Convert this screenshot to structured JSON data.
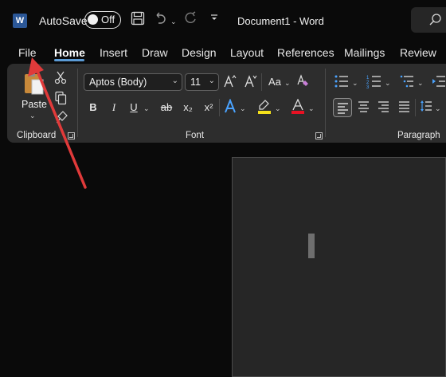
{
  "titlebar": {
    "autosave_label": "AutoSave",
    "autosave_state": "Off",
    "document_title": "Document1  -  Word",
    "icons": [
      "word-logo-icon",
      "save-icon",
      "undo-icon",
      "redo-icon",
      "customize-toolbar-icon",
      "search-icon"
    ]
  },
  "tabs": [
    {
      "label": "File"
    },
    {
      "label": "Home",
      "active": true
    },
    {
      "label": "Insert"
    },
    {
      "label": "Draw"
    },
    {
      "label": "Design"
    },
    {
      "label": "Layout"
    },
    {
      "label": "References"
    },
    {
      "label": "Mailings"
    },
    {
      "label": "Review"
    }
  ],
  "ribbon": {
    "clipboard": {
      "group_label": "Clipboard",
      "paste_label": "Paste"
    },
    "font": {
      "group_label": "Font",
      "font_name": "Aptos (Body)",
      "font_size": "11",
      "buttons": {
        "bold": "B",
        "italic": "I",
        "underline": "U",
        "strike": "ab",
        "subscript": "x₂",
        "superscript": "x²",
        "grow": "A^",
        "shrink": "A˅",
        "change_case": "Aa"
      },
      "highlight_color": "#f5e11b",
      "font_color": "#e81123"
    },
    "paragraph": {
      "group_label": "Paragraph"
    }
  },
  "colors": {
    "accent": "#5b9bd5",
    "annotation_arrow": "#e03a3a",
    "ribbon_bg": "#2d2d2d"
  }
}
